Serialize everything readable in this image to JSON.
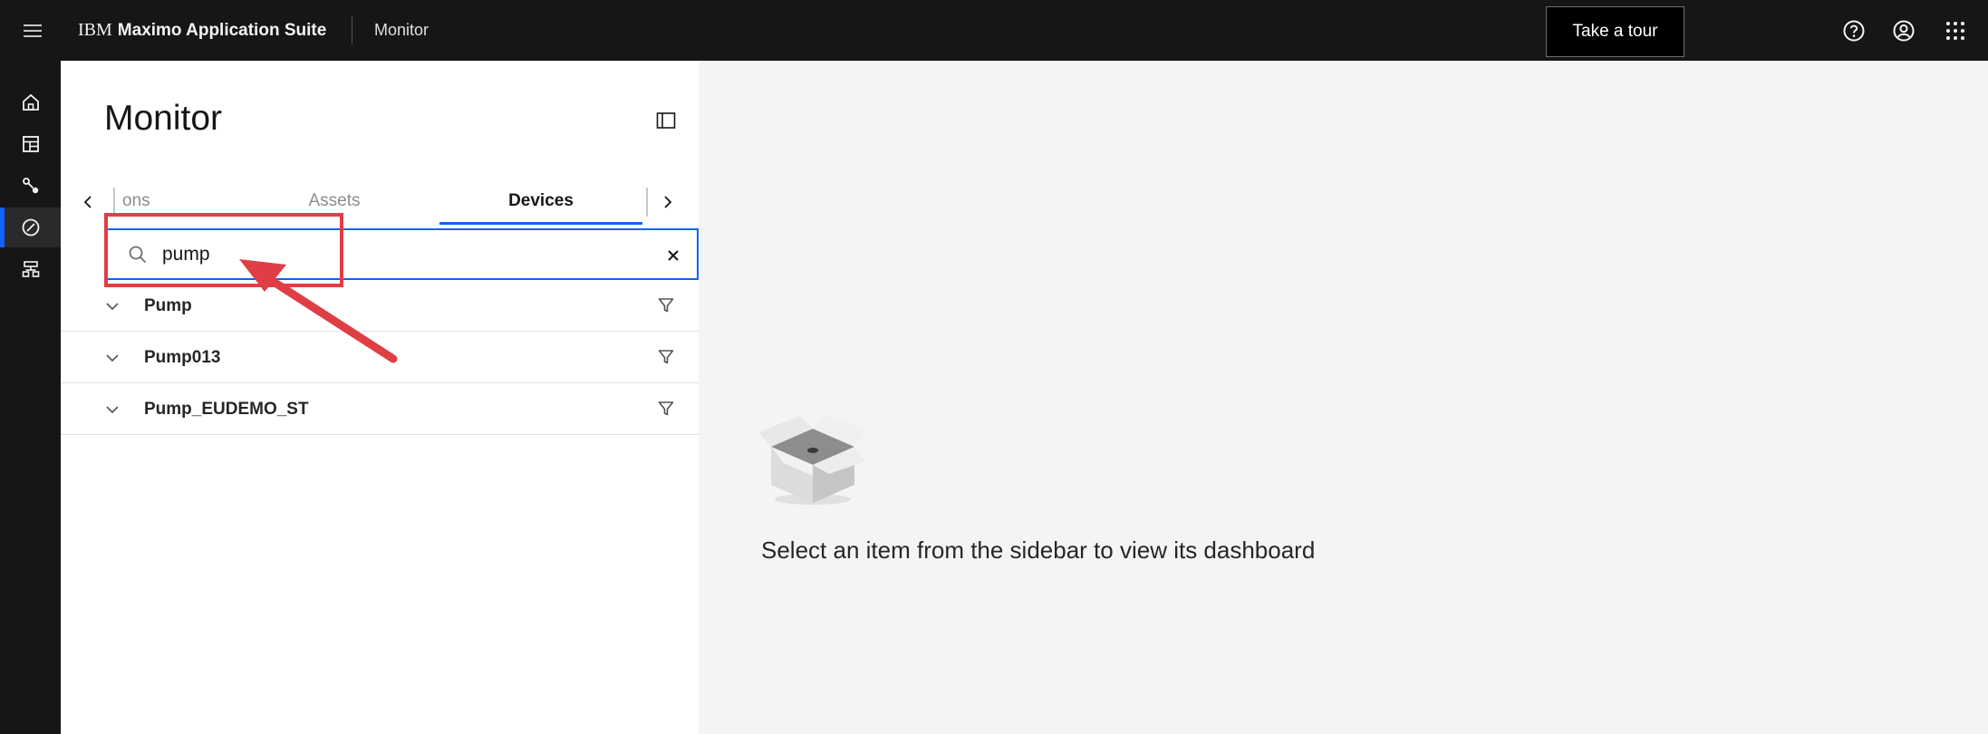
{
  "header": {
    "brand_prefix": "IBM",
    "brand_product": "Maximo Application Suite",
    "app_name": "Monitor",
    "tour_button": "Take a tour",
    "icons": [
      "menu-icon",
      "help-icon",
      "user-avatar-icon",
      "app-switcher-icon"
    ]
  },
  "rail": {
    "items": [
      {
        "icon": "home-icon",
        "active": false
      },
      {
        "icon": "dashboard-icon",
        "active": false
      },
      {
        "icon": "connections-icon",
        "active": false
      },
      {
        "icon": "monitor-compass-icon",
        "active": true
      },
      {
        "icon": "hierarchy-icon",
        "active": false
      }
    ]
  },
  "panel": {
    "title": "Monitor",
    "tabs": {
      "partial_label": "ons",
      "assets_label": "Assets",
      "devices_label": "Devices",
      "active": "Devices"
    },
    "search": {
      "value": "pump"
    },
    "results": [
      {
        "label": "Pump"
      },
      {
        "label": "Pump013"
      },
      {
        "label": "Pump_EUDEMO_ST"
      }
    ]
  },
  "main": {
    "empty_message": "Select an item from the sidebar to view its dashboard"
  },
  "colors": {
    "header_bg": "#161616",
    "accent": "#0f62fe",
    "annotation": "#e03e45"
  }
}
